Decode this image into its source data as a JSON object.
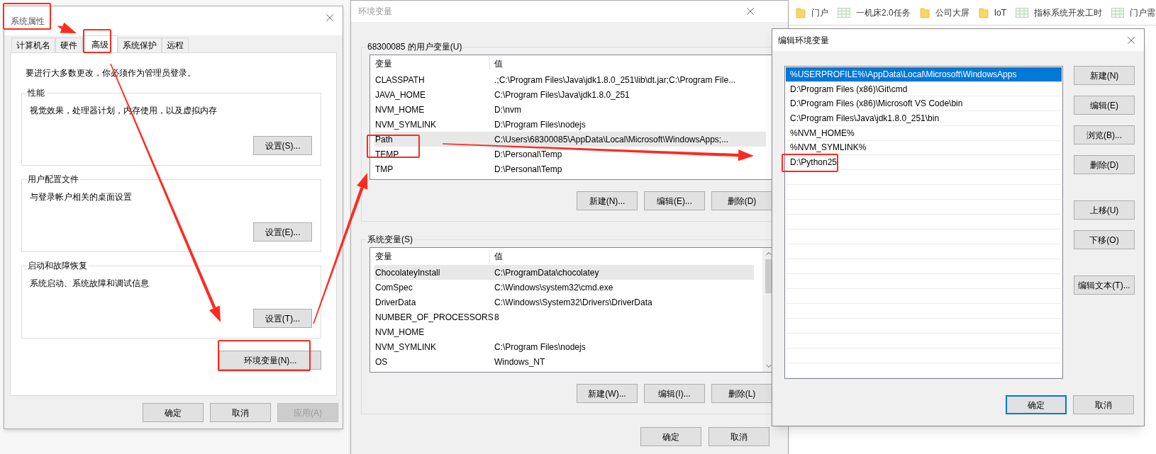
{
  "browser_bookmarks": [
    {
      "label": "门户",
      "kind": "folder"
    },
    {
      "label": "一机床2.0任务",
      "kind": "sheet"
    },
    {
      "label": "公司大屏",
      "kind": "folder"
    },
    {
      "label": "IoT",
      "kind": "folder"
    },
    {
      "label": "指标系统开发工时",
      "kind": "sheet"
    },
    {
      "label": "门户需",
      "kind": "sheet"
    }
  ],
  "system_properties": {
    "title": "系统属性",
    "tabs": [
      {
        "label": "计算机名",
        "selected": false
      },
      {
        "label": "硬件",
        "selected": false
      },
      {
        "label": "高级",
        "selected": true
      },
      {
        "label": "系统保护",
        "selected": false
      },
      {
        "label": "远程",
        "selected": false
      }
    ],
    "admin_note": "要进行大多数更改，你必须作为管理员登录。",
    "groups": [
      {
        "title": "性能",
        "description": "视觉效果，处理器计划，内存使用，以及虚拟内存",
        "button": "设置(S)..."
      },
      {
        "title": "用户配置文件",
        "description": "与登录帐户相关的桌面设置",
        "button": "设置(E)..."
      },
      {
        "title": "启动和故障恢复",
        "description": "系统启动、系统故障和调试信息",
        "button": "设置(T)..."
      }
    ],
    "env_button": "环境变量(N)...",
    "buttons": [
      {
        "label": "确定",
        "disabled": false
      },
      {
        "label": "取消",
        "disabled": false
      },
      {
        "label": "应用(A)",
        "disabled": true
      }
    ]
  },
  "environment_variables": {
    "title": "环境变量",
    "user_group": {
      "title": "68300085 的用户变量(U)",
      "columns": [
        "变量",
        "值"
      ],
      "rows": [
        {
          "name": "CLASSPATH",
          "value": ".;C:\\Program Files\\Java\\jdk1.8.0_251\\lib\\dt.jar;C:\\Program File...",
          "selected": false
        },
        {
          "name": "JAVA_HOME",
          "value": "C:\\Program Files\\Java\\jdk1.8.0_251",
          "selected": false
        },
        {
          "name": "NVM_HOME",
          "value": "D:\\nvm",
          "selected": false
        },
        {
          "name": "NVM_SYMLINK",
          "value": "D:\\Program Files\\nodejs",
          "selected": false
        },
        {
          "name": "Path",
          "value": "C:\\Users\\68300085\\AppData\\Local\\Microsoft\\WindowsApps;...",
          "selected": true
        },
        {
          "name": "TEMP",
          "value": "D:\\Personal\\Temp",
          "selected": false
        },
        {
          "name": "TMP",
          "value": "D:\\Personal\\Temp",
          "selected": false
        }
      ],
      "buttons": [
        "新建(N)...",
        "编辑(E)...",
        "删除(D)"
      ]
    },
    "system_group": {
      "title": "系统变量(S)",
      "columns": [
        "变量",
        "值"
      ],
      "rows": [
        {
          "name": "ChocolateyInstall",
          "value": "C:\\ProgramData\\chocolatey",
          "selected": true
        },
        {
          "name": "ComSpec",
          "value": "C:\\Windows\\system32\\cmd.exe",
          "selected": false
        },
        {
          "name": "DriverData",
          "value": "C:\\Windows\\System32\\Drivers\\DriverData",
          "selected": false
        },
        {
          "name": "NUMBER_OF_PROCESSORS",
          "value": "8",
          "selected": false
        },
        {
          "name": "NVM_HOME",
          "value": "",
          "selected": false
        },
        {
          "name": "NVM_SYMLINK",
          "value": "C:\\Program Files\\nodejs",
          "selected": false
        },
        {
          "name": "OS",
          "value": "Windows_NT",
          "selected": false
        }
      ],
      "buttons": [
        "新建(W)...",
        "编辑(I)...",
        "删除(L)"
      ]
    },
    "buttons": [
      "确定",
      "取消"
    ]
  },
  "edit_variable": {
    "title": "编辑环境变量",
    "items": [
      {
        "text": "%USERPROFILE%\\AppData\\Local\\Microsoft\\WindowsApps",
        "selected": true
      },
      {
        "text": "D:\\Program Files (x86)\\Git\\cmd",
        "selected": false
      },
      {
        "text": "D:\\Program Files (x86)\\Microsoft VS Code\\bin",
        "selected": false
      },
      {
        "text": "C:\\Program Files\\Java\\jdk1.8.0_251\\bin",
        "selected": false
      },
      {
        "text": "%NVM_HOME%",
        "selected": false
      },
      {
        "text": "%NVM_SYMLINK%",
        "selected": false
      },
      {
        "text": "D:\\Python25",
        "selected": false
      }
    ],
    "side_buttons": [
      {
        "label": "新建(N)",
        "kind": "top"
      },
      {
        "label": "编辑(E)",
        "kind": "top"
      },
      {
        "label": "浏览(B)...",
        "kind": "top"
      },
      {
        "label": "删除(D)",
        "kind": "top"
      },
      {
        "label": "上移(U)",
        "kind": "gap"
      },
      {
        "label": "下移(O)",
        "kind": "top"
      },
      {
        "label": "编辑文本(T)...",
        "kind": "gap"
      }
    ],
    "footer_buttons": [
      {
        "label": "确定",
        "default": true
      },
      {
        "label": "取消",
        "default": false
      }
    ]
  }
}
